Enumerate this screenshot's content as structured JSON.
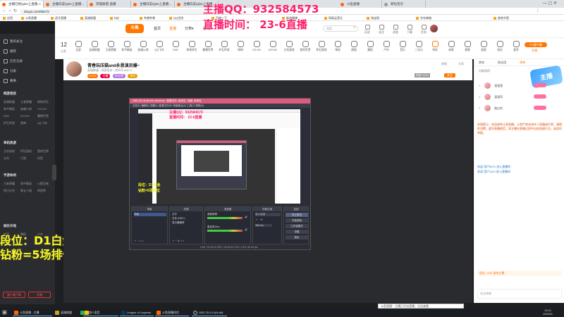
{
  "browser": {
    "tabs": [
      {
        "label": "主播已经/glue上直播…"
      },
      {
        "label": "主播白菜/glue上直播…"
      },
      {
        "label": "英雄联盟·直播"
      },
      {
        "label": "主播白菜/glue上直播…"
      },
      {
        "label": "主播白菜/glue上直播…"
      },
      {
        "label": "斗鱼直播"
      },
      {
        "label": "新标签页"
      }
    ],
    "url": "douyu.com/68172",
    "bookmarks": [
      "应用",
      "斗鱼直播",
      "虎牙直播",
      "英雄联盟",
      "B站",
      "哔哩哔哩",
      "QQ空间",
      "百度一下",
      "新浪微博",
      "网易云音乐",
      "淘宝网",
      "京东商城",
      "其他书签"
    ]
  },
  "overlay": {
    "qq_line": "主播QQ：932584573",
    "time_line": "直播时间： 23-6直播",
    "rank_line1": "段位：D1白金",
    "rank_line2": "钻粉=5场排位"
  },
  "sidebar": {
    "top_items": [
      "我的关注",
      "推荐",
      "历史记录",
      "分类",
      "赛事"
    ],
    "section1": {
      "title": "网游竞技",
      "cells": [
        "英雄联盟",
        "王者荣耀",
        "绝地求生",
        "和平精英",
        "穿越火线",
        "CS:GO",
        "DNF",
        "DOTA2",
        "魔兽世界",
        "炉石传说",
        "原神",
        "QQ飞车"
      ]
    },
    "section2": {
      "title": "单机热游",
      "cells": [
        "主机游戏",
        "怀旧游戏",
        "我的世界",
        "方舟",
        "只狼",
        "饥荒"
      ]
    },
    "section3": {
      "title": "手游休闲",
      "cells": [
        "王者荣耀",
        "和平精英",
        "火影忍者",
        "明日方舟",
        "第五人格",
        "阴阳师"
      ]
    },
    "section4": {
      "title": "娱乐天地",
      "cells": [
        "颜值",
        "舞蹈",
        "户外",
        "音乐"
      ]
    },
    "bottom_buttons": [
      "客户端下载",
      "开播"
    ]
  },
  "header": {
    "logo": "斗鱼",
    "nav": [
      "首页",
      "直播",
      "分类▾",
      "游戏▾"
    ],
    "search_placeholder": "搜索",
    "icons": [
      {
        "name": "history-icon",
        "label": "历史"
      },
      {
        "name": "follow-icon",
        "label": "关注"
      },
      {
        "name": "message-icon",
        "label": "消息"
      },
      {
        "name": "download-icon",
        "label": "下载"
      },
      {
        "name": "task-icon",
        "label": "任务"
      },
      {
        "name": "avatar-icon",
        "label": "我的"
      }
    ]
  },
  "categories": {
    "count": "12",
    "count_label": "分类",
    "items": [
      "全部",
      "英雄联盟",
      "王者荣耀",
      "和平精英",
      "穿越火线",
      "QQ飞车",
      "DNF",
      "绝地求生",
      "魔兽世界",
      "炉石传说",
      "原神",
      "CS:GO",
      "DOTA2",
      "主机游戏",
      "我的世界",
      "怀旧游戏",
      "单机",
      "颜值",
      "舞蹈",
      "户外",
      "音乐",
      "二次元",
      "科技",
      "体育",
      "美食",
      "旅游",
      "电台",
      "星秀"
    ],
    "pc_download": "PC客户端",
    "open_label": "开播"
  },
  "room": {
    "title": "青春玩压猫and永恩演员爆~",
    "meta": "英雄联盟 · 网游竞技 · 房间号 68172",
    "tags": [
      "LV22",
      "主播",
      "粉丝牌",
      "排位"
    ],
    "hot": "热度 2534",
    "share": "分享",
    "follow": "关注",
    "report": "举报"
  },
  "obs": {
    "title": "OBS 25.0.8 (64-bit, windows) - 配置文件: 未命名 - 场景: 未命名",
    "menu": "文件(F)  编辑(E)  视图(V)  配置文件(P)  场景集合(S)  工具(T)  帮助(H)",
    "docks": [
      "场景",
      "来源",
      "混音器",
      "场景过渡",
      "控制"
    ],
    "scenes": [
      "场景"
    ],
    "sources": [
      "文字",
      "文本 (GDI+)",
      "显示器捕获"
    ],
    "mixer": [
      "桌面音频",
      "麦克风/Aux"
    ],
    "transition": "淡入淡出",
    "transition_duration": "300 ms",
    "controls": [
      "停止推流",
      "开始录制",
      "工作室模式",
      "设置",
      "退出"
    ],
    "status": "LIVE: 00:15:22   REC: 00:00:00   CPU: 4.5%, 60.00 fps"
  },
  "chat": {
    "tabs": [
      "贵宾",
      "粉丝团",
      "榜单"
    ],
    "rank_title": "贡献周榜",
    "rank": [
      {
        "n": "1",
        "name": "溜溜溜"
      },
      {
        "n": "2",
        "name": "溜溜哥"
      },
      {
        "n": "3",
        "name": "路过的"
      }
    ],
    "messages": [
      "系统提示：欢迎来到斗鱼直播，斗鱼严禁未成年人直播或打赏，请理性消费，遵守直播规范。如主播在直播过程中出现违规行为，请及时举报。",
      "欢迎 用户8372 进入直播间",
      "欢迎 用户1124 进入直播间"
    ],
    "gift_bar": "鱼丸 ×100 送给主播",
    "input_placeholder": "发送弹幕"
  },
  "popup_text": "斗鱼直播：主播已开启直播，点击查看",
  "taskbar": {
    "items": [
      "斗鱼直播 - 主播",
      "英雄联盟",
      "微信",
      "YY语音",
      "League of Legends",
      "斗鱼直播伴侣",
      "OBS 25.0.8 (64-bit)"
    ],
    "clock": "19:21",
    "date": "2020/5/4"
  },
  "colors": {
    "brand": "#ff7700",
    "overlay_pink": "#ff1d6b",
    "overlay_yellow": "#f8f820",
    "obs_title": "#dd5c7d"
  }
}
